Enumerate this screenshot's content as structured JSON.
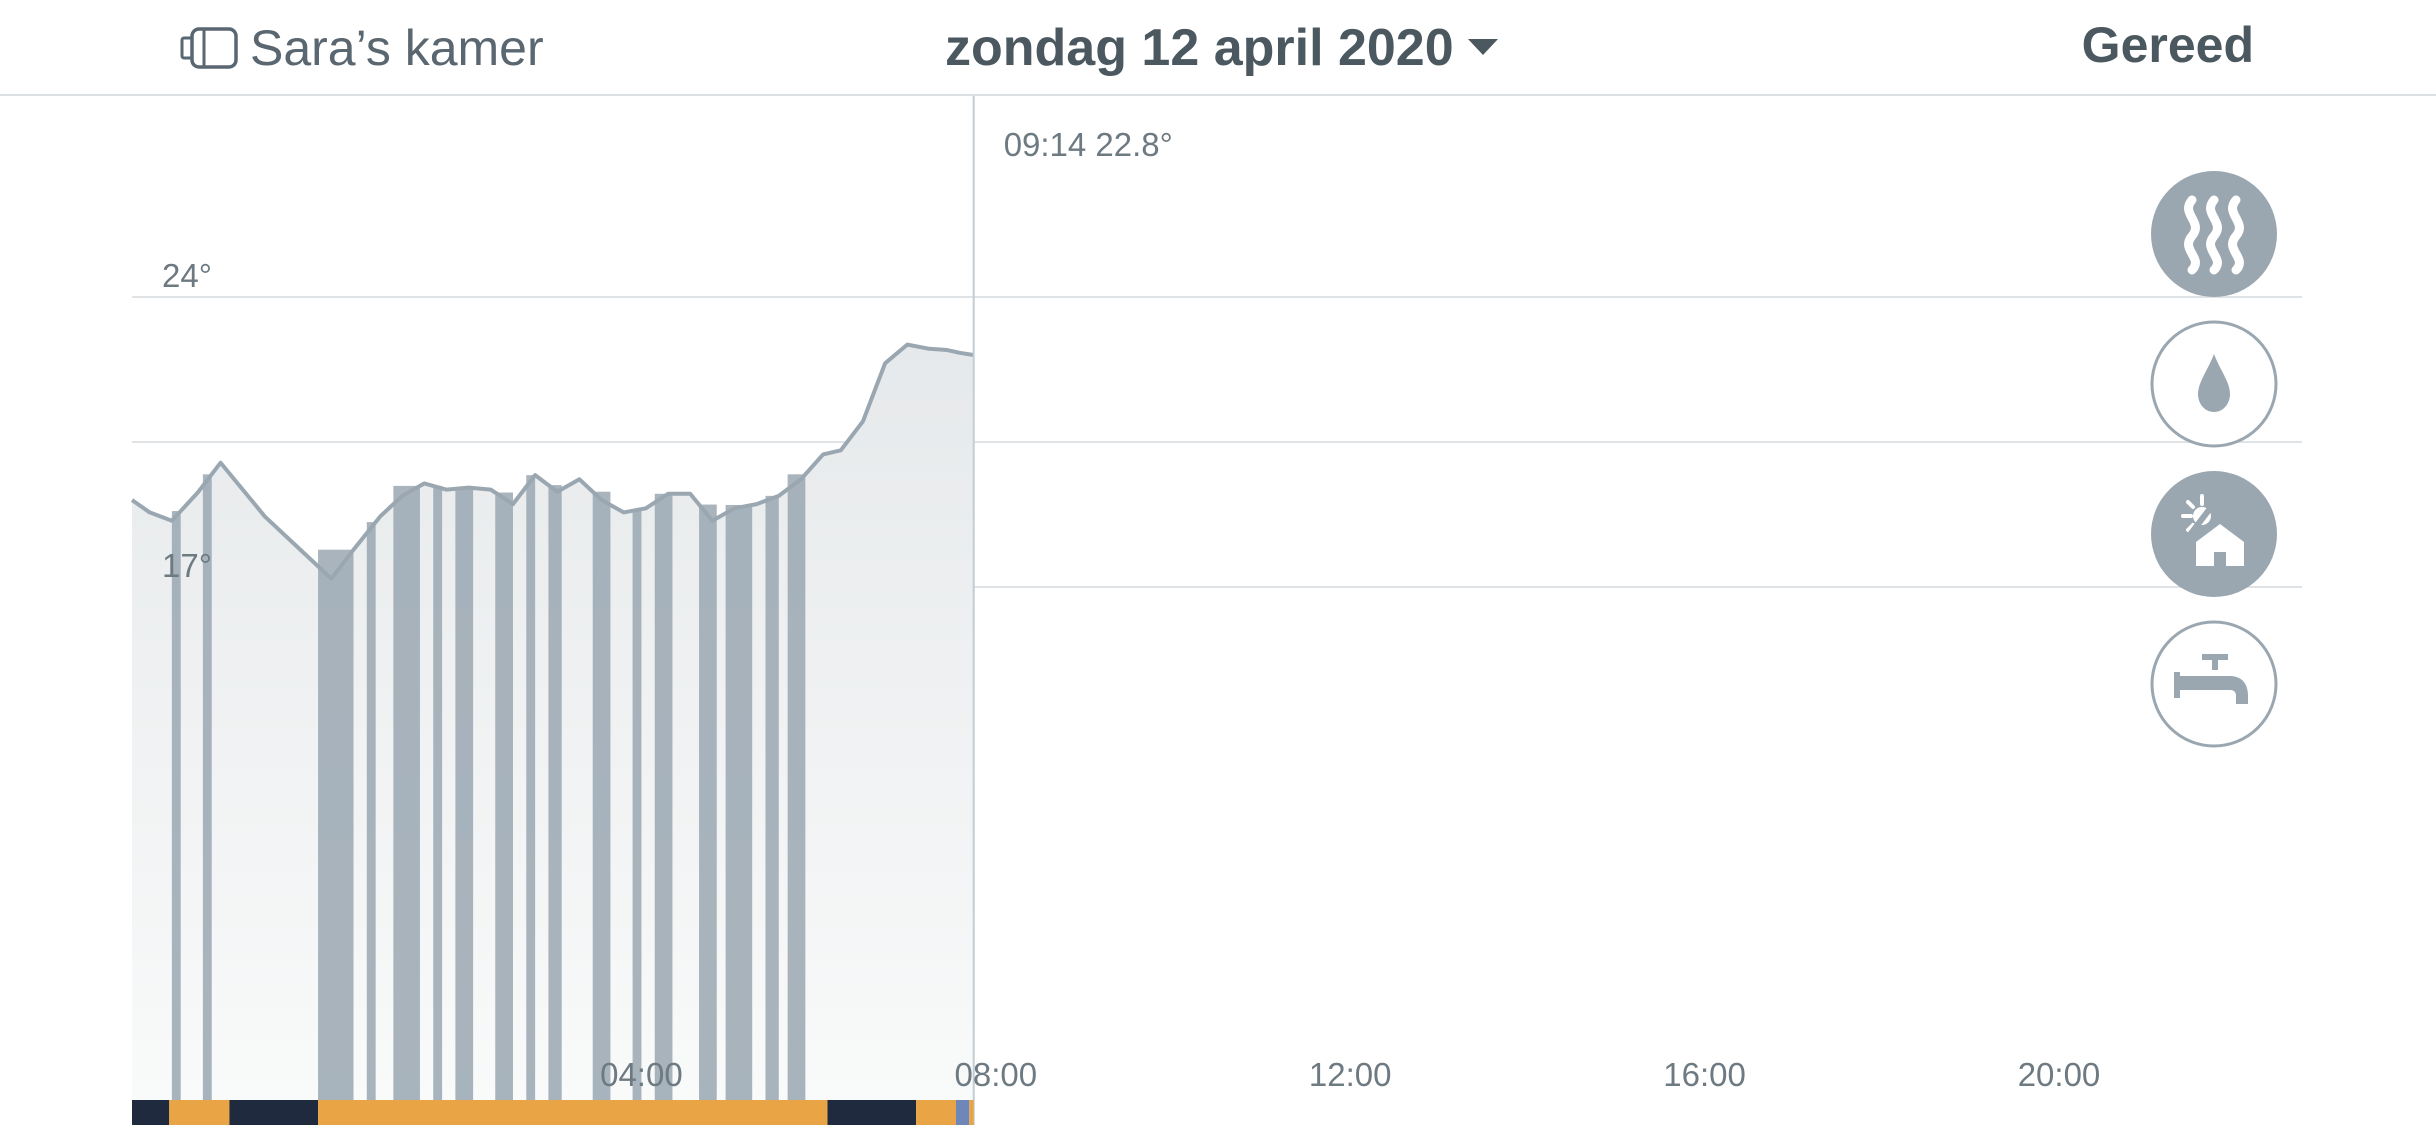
{
  "header": {
    "room_label": "Sara’s kamer",
    "date_label": "zondag 12 april 2020",
    "done_label": "Gereed"
  },
  "cursor": {
    "time": "09:14",
    "value": "22.8°",
    "label": "09:14 22.8°"
  },
  "side_buttons": [
    {
      "name": "heating-toggle",
      "icon": "heat-waves-icon",
      "active": true
    },
    {
      "name": "humidity-toggle",
      "icon": "water-drop-icon",
      "active": false
    },
    {
      "name": "outdoor-toggle",
      "icon": "sun-house-icon",
      "active": true
    },
    {
      "name": "hot-water-toggle",
      "icon": "water-tap-icon",
      "active": false
    }
  ],
  "colors": {
    "line": "#9aa7b1",
    "bar": "#9aa7b1",
    "grid": "#dfe3e6",
    "active_button": "#9aa7b1",
    "status_active": "#e8a445",
    "status_idle": "#1f2a3f",
    "status_blue": "#6f87b8"
  },
  "chart_data": {
    "type": "area",
    "x_unit": "hours",
    "x_range": [
      0,
      24
    ],
    "y_range": [
      13,
      27
    ],
    "y_gridlines": [
      24,
      20.5,
      17
    ],
    "y_tick_labels": [
      "24°",
      "17°"
    ],
    "x_ticks": [
      {
        "x": 4,
        "label": "04:00"
      },
      {
        "x": 8,
        "label": "08:00"
      },
      {
        "x": 12,
        "label": "12:00"
      },
      {
        "x": 16,
        "label": "16:00"
      },
      {
        "x": 20,
        "label": "20:00"
      }
    ],
    "cursor_x": 9.5,
    "series": [
      {
        "values": [
          [
            0,
            19.1
          ],
          [
            0.2,
            18.8
          ],
          [
            0.45,
            18.6
          ],
          [
            0.75,
            19.3
          ],
          [
            1.0,
            20.0
          ],
          [
            1.5,
            18.7
          ],
          [
            2.0,
            17.7
          ],
          [
            2.25,
            17.2
          ],
          [
            2.5,
            17.9
          ],
          [
            2.8,
            18.7
          ],
          [
            3.05,
            19.2
          ],
          [
            3.3,
            19.5
          ],
          [
            3.55,
            19.35
          ],
          [
            3.8,
            19.4
          ],
          [
            4.05,
            19.35
          ],
          [
            4.3,
            19.0
          ],
          [
            4.55,
            19.7
          ],
          [
            4.8,
            19.3
          ],
          [
            5.05,
            19.6
          ],
          [
            5.3,
            19.1
          ],
          [
            5.55,
            18.8
          ],
          [
            5.8,
            18.9
          ],
          [
            6.05,
            19.25
          ],
          [
            6.3,
            19.25
          ],
          [
            6.55,
            18.6
          ],
          [
            6.8,
            18.9
          ],
          [
            7.05,
            19.0
          ],
          [
            7.3,
            19.2
          ],
          [
            7.55,
            19.6
          ],
          [
            7.8,
            20.2
          ],
          [
            8.0,
            20.3
          ],
          [
            8.25,
            21.0
          ],
          [
            8.5,
            22.4
          ],
          [
            8.75,
            22.85
          ],
          [
            9.0,
            22.75
          ],
          [
            9.2,
            22.72
          ],
          [
            9.35,
            22.65
          ],
          [
            9.5,
            22.6
          ]
        ]
      }
    ],
    "heating_bars": [
      [
        0.45,
        0.55
      ],
      [
        0.8,
        0.9
      ],
      [
        2.1,
        2.5
      ],
      [
        2.65,
        2.75
      ],
      [
        2.95,
        3.25
      ],
      [
        3.4,
        3.5
      ],
      [
        3.65,
        3.85
      ],
      [
        4.1,
        4.3
      ],
      [
        4.45,
        4.55
      ],
      [
        4.7,
        4.85
      ],
      [
        5.2,
        5.4
      ],
      [
        5.65,
        5.75
      ],
      [
        5.9,
        6.1
      ],
      [
        6.4,
        6.6
      ],
      [
        6.7,
        7.0
      ],
      [
        7.15,
        7.3
      ],
      [
        7.4,
        7.6
      ]
    ],
    "status_segments": [
      {
        "start": 0,
        "end": 0.42,
        "state": "idle"
      },
      {
        "start": 0.42,
        "end": 1.1,
        "state": "active"
      },
      {
        "start": 1.1,
        "end": 2.1,
        "state": "idle"
      },
      {
        "start": 2.1,
        "end": 7.85,
        "state": "active"
      },
      {
        "start": 7.85,
        "end": 8.85,
        "state": "idle"
      },
      {
        "start": 8.85,
        "end": 9.3,
        "state": "active"
      },
      {
        "start": 9.3,
        "end": 9.45,
        "state": "blue"
      },
      {
        "start": 9.45,
        "end": 9.5,
        "state": "active"
      }
    ]
  }
}
